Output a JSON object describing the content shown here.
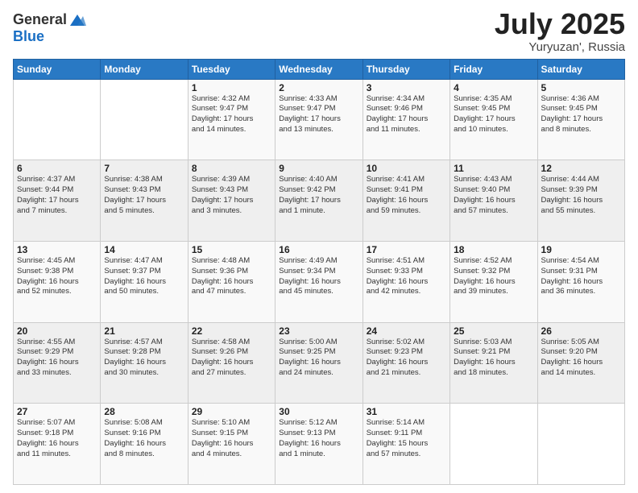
{
  "header": {
    "logo_general": "General",
    "logo_blue": "Blue",
    "title": "July 2025",
    "location": "Yuryuzan', Russia"
  },
  "weekdays": [
    "Sunday",
    "Monday",
    "Tuesday",
    "Wednesday",
    "Thursday",
    "Friday",
    "Saturday"
  ],
  "weeks": [
    [
      {
        "day": "",
        "info": ""
      },
      {
        "day": "",
        "info": ""
      },
      {
        "day": "1",
        "info": "Sunrise: 4:32 AM\nSunset: 9:47 PM\nDaylight: 17 hours\nand 14 minutes."
      },
      {
        "day": "2",
        "info": "Sunrise: 4:33 AM\nSunset: 9:47 PM\nDaylight: 17 hours\nand 13 minutes."
      },
      {
        "day": "3",
        "info": "Sunrise: 4:34 AM\nSunset: 9:46 PM\nDaylight: 17 hours\nand 11 minutes."
      },
      {
        "day": "4",
        "info": "Sunrise: 4:35 AM\nSunset: 9:45 PM\nDaylight: 17 hours\nand 10 minutes."
      },
      {
        "day": "5",
        "info": "Sunrise: 4:36 AM\nSunset: 9:45 PM\nDaylight: 17 hours\nand 8 minutes."
      }
    ],
    [
      {
        "day": "6",
        "info": "Sunrise: 4:37 AM\nSunset: 9:44 PM\nDaylight: 17 hours\nand 7 minutes."
      },
      {
        "day": "7",
        "info": "Sunrise: 4:38 AM\nSunset: 9:43 PM\nDaylight: 17 hours\nand 5 minutes."
      },
      {
        "day": "8",
        "info": "Sunrise: 4:39 AM\nSunset: 9:43 PM\nDaylight: 17 hours\nand 3 minutes."
      },
      {
        "day": "9",
        "info": "Sunrise: 4:40 AM\nSunset: 9:42 PM\nDaylight: 17 hours\nand 1 minute."
      },
      {
        "day": "10",
        "info": "Sunrise: 4:41 AM\nSunset: 9:41 PM\nDaylight: 16 hours\nand 59 minutes."
      },
      {
        "day": "11",
        "info": "Sunrise: 4:43 AM\nSunset: 9:40 PM\nDaylight: 16 hours\nand 57 minutes."
      },
      {
        "day": "12",
        "info": "Sunrise: 4:44 AM\nSunset: 9:39 PM\nDaylight: 16 hours\nand 55 minutes."
      }
    ],
    [
      {
        "day": "13",
        "info": "Sunrise: 4:45 AM\nSunset: 9:38 PM\nDaylight: 16 hours\nand 52 minutes."
      },
      {
        "day": "14",
        "info": "Sunrise: 4:47 AM\nSunset: 9:37 PM\nDaylight: 16 hours\nand 50 minutes."
      },
      {
        "day": "15",
        "info": "Sunrise: 4:48 AM\nSunset: 9:36 PM\nDaylight: 16 hours\nand 47 minutes."
      },
      {
        "day": "16",
        "info": "Sunrise: 4:49 AM\nSunset: 9:34 PM\nDaylight: 16 hours\nand 45 minutes."
      },
      {
        "day": "17",
        "info": "Sunrise: 4:51 AM\nSunset: 9:33 PM\nDaylight: 16 hours\nand 42 minutes."
      },
      {
        "day": "18",
        "info": "Sunrise: 4:52 AM\nSunset: 9:32 PM\nDaylight: 16 hours\nand 39 minutes."
      },
      {
        "day": "19",
        "info": "Sunrise: 4:54 AM\nSunset: 9:31 PM\nDaylight: 16 hours\nand 36 minutes."
      }
    ],
    [
      {
        "day": "20",
        "info": "Sunrise: 4:55 AM\nSunset: 9:29 PM\nDaylight: 16 hours\nand 33 minutes."
      },
      {
        "day": "21",
        "info": "Sunrise: 4:57 AM\nSunset: 9:28 PM\nDaylight: 16 hours\nand 30 minutes."
      },
      {
        "day": "22",
        "info": "Sunrise: 4:58 AM\nSunset: 9:26 PM\nDaylight: 16 hours\nand 27 minutes."
      },
      {
        "day": "23",
        "info": "Sunrise: 5:00 AM\nSunset: 9:25 PM\nDaylight: 16 hours\nand 24 minutes."
      },
      {
        "day": "24",
        "info": "Sunrise: 5:02 AM\nSunset: 9:23 PM\nDaylight: 16 hours\nand 21 minutes."
      },
      {
        "day": "25",
        "info": "Sunrise: 5:03 AM\nSunset: 9:21 PM\nDaylight: 16 hours\nand 18 minutes."
      },
      {
        "day": "26",
        "info": "Sunrise: 5:05 AM\nSunset: 9:20 PM\nDaylight: 16 hours\nand 14 minutes."
      }
    ],
    [
      {
        "day": "27",
        "info": "Sunrise: 5:07 AM\nSunset: 9:18 PM\nDaylight: 16 hours\nand 11 minutes."
      },
      {
        "day": "28",
        "info": "Sunrise: 5:08 AM\nSunset: 9:16 PM\nDaylight: 16 hours\nand 8 minutes."
      },
      {
        "day": "29",
        "info": "Sunrise: 5:10 AM\nSunset: 9:15 PM\nDaylight: 16 hours\nand 4 minutes."
      },
      {
        "day": "30",
        "info": "Sunrise: 5:12 AM\nSunset: 9:13 PM\nDaylight: 16 hours\nand 1 minute."
      },
      {
        "day": "31",
        "info": "Sunrise: 5:14 AM\nSunset: 9:11 PM\nDaylight: 15 hours\nand 57 minutes."
      },
      {
        "day": "",
        "info": ""
      },
      {
        "day": "",
        "info": ""
      }
    ]
  ]
}
